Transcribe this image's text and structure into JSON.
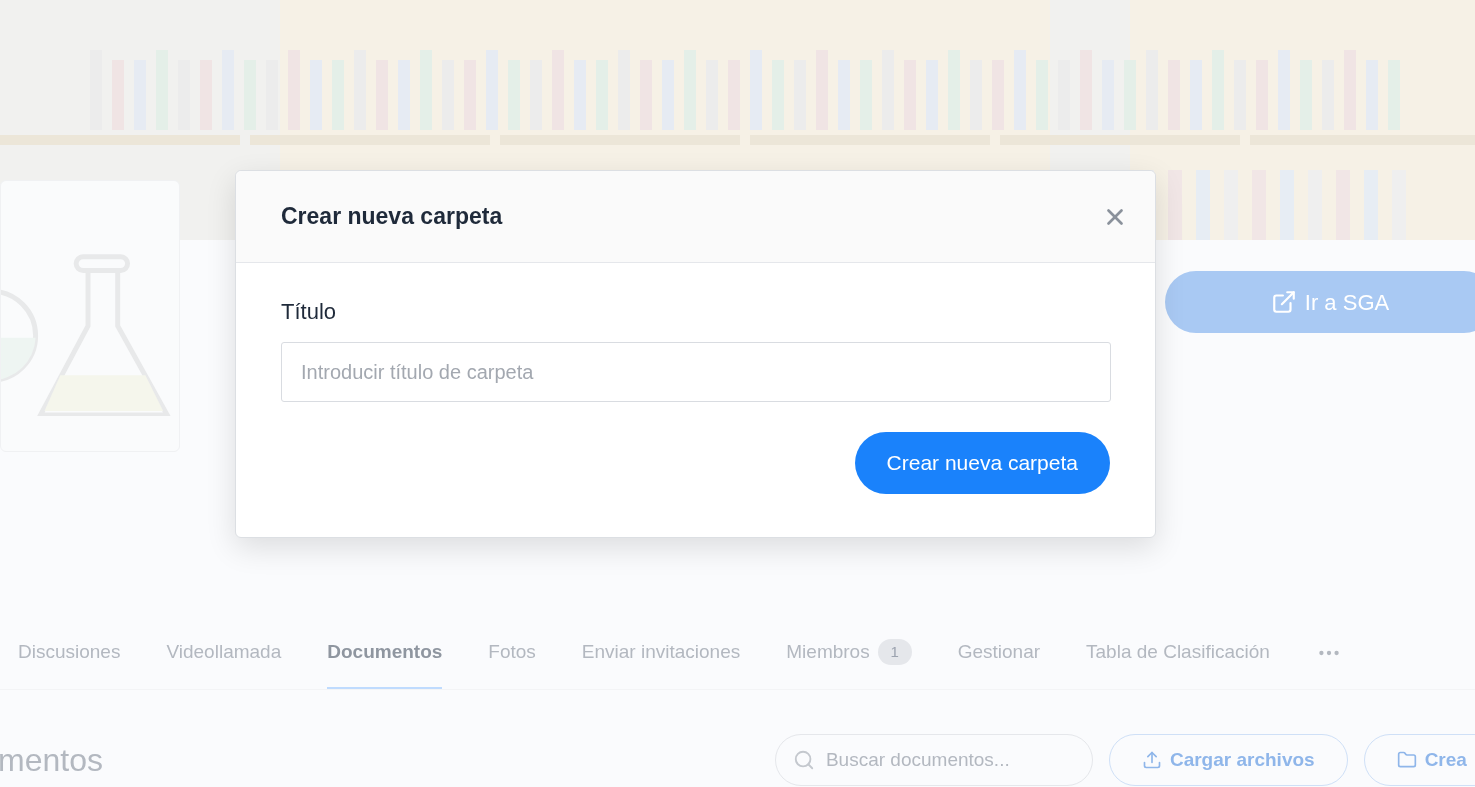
{
  "group": {
    "action_button": "Ir a SGA"
  },
  "tabs": [
    {
      "label": "Discusiones",
      "selected": false
    },
    {
      "label": "Videollamada",
      "selected": false
    },
    {
      "label": "Documentos",
      "selected": true
    },
    {
      "label": "Fotos",
      "selected": false
    },
    {
      "label": "Enviar invitaciones",
      "selected": false
    },
    {
      "label": "Miembros",
      "selected": false,
      "badge": "1"
    },
    {
      "label": "Gestionar",
      "selected": false
    },
    {
      "label": "Tabla de Clasificación",
      "selected": false
    }
  ],
  "documents": {
    "heading": "mentos",
    "search": {
      "placeholder": "Buscar documentos..."
    },
    "buttons": [
      "Cargar archivos",
      "Crea"
    ]
  },
  "dialog": {
    "title": "Crear nueva carpeta",
    "field_label": "Título",
    "field": {
      "placeholder": "Introducir título de carpeta"
    },
    "submit": "Crear nueva carpeta"
  }
}
